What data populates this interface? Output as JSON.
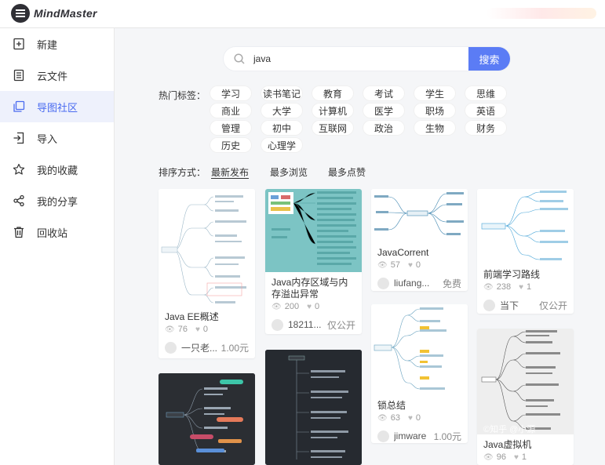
{
  "app": {
    "logo_text": "MindMaster"
  },
  "sidebar": {
    "items": [
      {
        "label": "新建",
        "icon": "new-file-icon"
      },
      {
        "label": "云文件",
        "icon": "cloud-file-icon"
      },
      {
        "label": "导图社区",
        "icon": "community-icon",
        "active": true
      },
      {
        "label": "导入",
        "icon": "import-icon"
      },
      {
        "label": "我的收藏",
        "icon": "star-icon"
      },
      {
        "label": "我的分享",
        "icon": "share-icon"
      },
      {
        "label": "回收站",
        "icon": "trash-icon"
      }
    ]
  },
  "search": {
    "value": "java",
    "button_label": "搜索"
  },
  "tags": {
    "label": "热门标签：",
    "items": [
      "学习",
      "读书笔记",
      "教育",
      "考试",
      "学生",
      "思维",
      "商业",
      "大学",
      "计算机",
      "医学",
      "职场",
      "英语",
      "管理",
      "初中",
      "互联网",
      "政治",
      "生物",
      "财务",
      "历史",
      "心理学"
    ]
  },
  "sort": {
    "label": "排序方式：",
    "options": [
      "最新发布",
      "最多浏览",
      "最多点赞"
    ],
    "active_index": 0
  },
  "cards": [
    {
      "title": "Java EE概述",
      "views": "76",
      "likes": "0",
      "author": "一只老...",
      "price": "1.00元"
    },
    {
      "title": "Java内存区域与内存溢出异常",
      "views": "200",
      "likes": "0",
      "author": "18211...",
      "price": "仅公开"
    },
    {
      "title": "JavaCorrent",
      "views": "57",
      "likes": "0",
      "author": "liufang...",
      "price": "免费"
    },
    {
      "title": "前端学习路线",
      "views": "238",
      "likes": "1",
      "author": "当下",
      "price": "仅公开"
    },
    {
      "title": "锁总结",
      "views": "63",
      "likes": "0",
      "author": "jimware",
      "price": "1.00元"
    },
    {
      "title": "Java虚拟机",
      "views": "96",
      "likes": "1",
      "author": "",
      "price": ""
    }
  ],
  "colors": {
    "accent": "#5b7cf5",
    "active_bg": "#eef1fc",
    "active_text": "#4a6bf0"
  }
}
